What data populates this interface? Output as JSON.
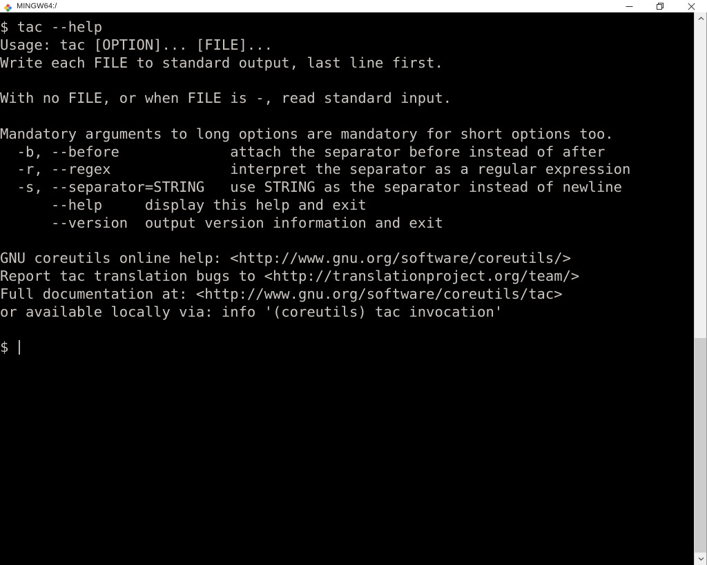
{
  "window": {
    "title": "MINGW64:/",
    "app_icon": "mintty-icon",
    "controls": [
      {
        "name": "minimize-button",
        "glyph": "minimize"
      },
      {
        "name": "maximize-button",
        "glyph": "maximize"
      },
      {
        "name": "close-button",
        "glyph": "close"
      }
    ]
  },
  "terminal": {
    "foreground_color": "#ccc6c1",
    "background_color": "#000000",
    "prompt": "$",
    "cursor": "bar",
    "lines": [
      "$ tac --help",
      "Usage: tac [OPTION]... [FILE]...",
      "Write each FILE to standard output, last line first.",
      "",
      "With no FILE, or when FILE is -, read standard input.",
      "",
      "Mandatory arguments to long options are mandatory for short options too.",
      "  -b, --before             attach the separator before instead of after",
      "  -r, --regex              interpret the separator as a regular expression",
      "  -s, --separator=STRING   use STRING as the separator instead of newline",
      "      --help     display this help and exit",
      "      --version  output version information and exit",
      "",
      "GNU coreutils online help: <http://www.gnu.org/software/coreutils/>",
      "Report tac translation bugs to <http://translationproject.org/team/>",
      "Full documentation at: <http://www.gnu.org/software/coreutils/tac>",
      "or available locally via: info '(coreutils) tac invocation'",
      ""
    ],
    "prompt_line": "$ "
  },
  "scrollbar": {
    "up_arrow": "chevron-up-icon",
    "down_arrow": "chevron-down-icon",
    "thumb_color": "#cdcdcd",
    "track_color": "#f0f0f0"
  }
}
